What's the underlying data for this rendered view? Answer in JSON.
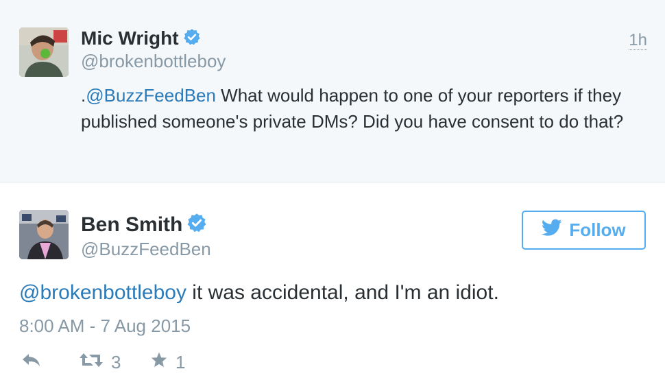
{
  "parent_tweet": {
    "author_name": "Mic Wright",
    "author_handle": "@brokenbottleboy",
    "time_ago": "1h",
    "text_prefix": ".",
    "mention": "@BuzzFeedBen",
    "text_rest": " What would happen to one of your reporters if they published someone's private DMs? Did you have consent to do that?"
  },
  "main_tweet": {
    "author_name": "Ben Smith",
    "author_handle": "@BuzzFeedBen",
    "follow_label": "Follow",
    "mention": "@brokenbottleboy",
    "text_rest": " it was accidental, and I'm an idiot.",
    "timestamp": "8:00 AM - 7 Aug 2015",
    "retweet_count": "3",
    "favorite_count": "1"
  },
  "colors": {
    "link": "#2b7bb9",
    "twitter_blue": "#55acee",
    "muted": "#8899a6",
    "parent_bg": "#f5f8fa"
  },
  "icons": [
    "verified-badge-icon",
    "twitter-bird-icon",
    "reply-icon",
    "retweet-icon",
    "favorite-star-icon"
  ]
}
